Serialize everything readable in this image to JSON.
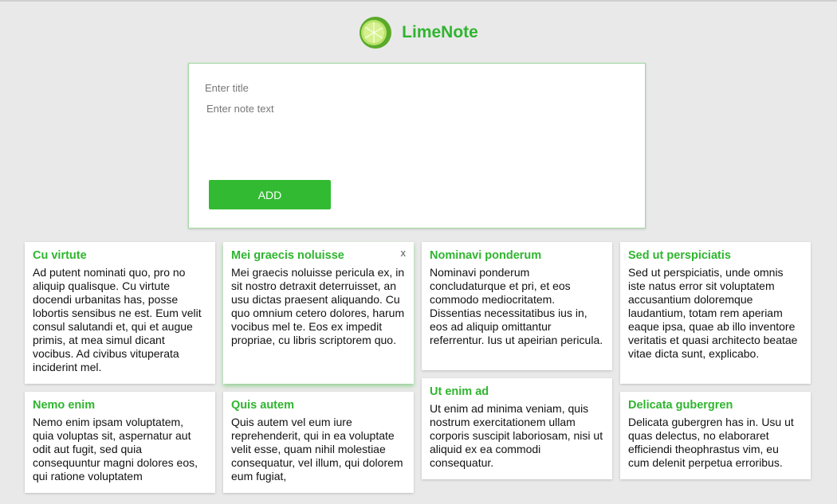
{
  "app": {
    "name": "LimeNote",
    "logo_icon": "lime-icon"
  },
  "form": {
    "title_placeholder": "Enter title",
    "text_placeholder": "Enter note text",
    "add_label": "ADD"
  },
  "notes": [
    {
      "title": "Cu virtute",
      "body": "Ad putent nominati quo, pro no aliquip qualisque. Cu virtute docendi urbanitas has, posse lobortis sensibus ne est. Eum velit consul salutandi et, qui et augue primis, at mea simul dicant vocibus. Ad civibus vituperata inciderint mel."
    },
    {
      "title": "Mei graecis noluisse",
      "body": "Mei graecis noluisse pericula ex, in sit nostro detraxit deterruisset, an usu dictas praesent aliquando. Cu quo omnium cetero dolores, harum vocibus mel te. Eos ex impedit propriae, cu libris scriptorem quo.",
      "close_label": "x"
    },
    {
      "title": "Nominavi ponderum",
      "body": "Nominavi ponderum concludaturque et pri, et eos commodo mediocritatem. Dissentias necessitatibus ius in, eos ad aliquip omittantur referrentur. Ius ut apeirian pericula."
    },
    {
      "title": "Sed ut perspiciatis",
      "body": "Sed ut perspiciatis, unde omnis iste natus error sit voluptatem accusantium doloremque laudantium, totam rem aperiam eaque ipsa, quae ab illo inventore veritatis et quasi architecto beatae vitae dicta sunt, explicabo."
    },
    {
      "title": "Nemo enim",
      "body": "Nemo enim ipsam voluptatem, quia voluptas sit, aspernatur aut odit aut fugit, sed quia consequuntur magni dolores eos, qui ratione voluptatem"
    },
    {
      "title": "Quis autem",
      "body": "Quis autem vel eum iure reprehenderit, qui in ea voluptate velit esse, quam nihil molestiae consequatur, vel illum, qui dolorem eum fugiat,"
    },
    {
      "title": "Ut enim ad",
      "body": "Ut enim ad minima veniam, quis nostrum exercitationem ullam corporis suscipit laboriosam, nisi ut aliquid ex ea commodi consequatur."
    },
    {
      "title": "Delicata gubergren",
      "body": "Delicata gubergren has in. Usu ut quas delectus, no elaboraret efficiendi theophrastus vim, eu cum delenit perpetua erroribus."
    }
  ]
}
